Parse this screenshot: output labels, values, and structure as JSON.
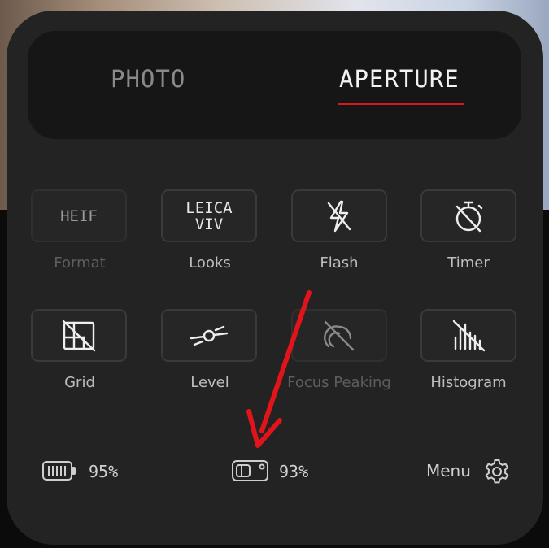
{
  "mode_tabs": [
    {
      "label": "PHOTO",
      "active": false
    },
    {
      "label": "APERTURE",
      "active": true
    }
  ],
  "accent_color": "#d8181f",
  "controls": [
    {
      "icon": "heif-format-icon",
      "tile_text": "HEIF",
      "label": "Format",
      "enabled": false
    },
    {
      "icon": "leica-viv-icon",
      "tile_text_line1": "LEICA",
      "tile_text_line2": "VIV",
      "label": "Looks",
      "enabled": true
    },
    {
      "icon": "flash-off-icon",
      "label": "Flash",
      "enabled": true
    },
    {
      "icon": "timer-off-icon",
      "label": "Timer",
      "enabled": true
    },
    {
      "icon": "grid-off-icon",
      "label": "Grid",
      "enabled": true
    },
    {
      "icon": "level-icon",
      "label": "Level",
      "enabled": true
    },
    {
      "icon": "focus-peaking-off-icon",
      "label": "Focus Peaking",
      "enabled": false
    },
    {
      "icon": "histogram-off-icon",
      "label": "Histogram",
      "enabled": true
    }
  ],
  "status": {
    "phone_battery": "95%",
    "camera_battery": "93%",
    "menu_label": "Menu"
  }
}
